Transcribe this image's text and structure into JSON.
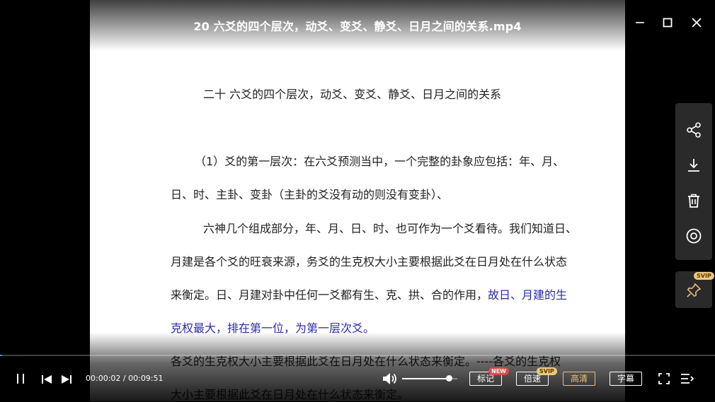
{
  "window": {
    "title": "20   六爻的四个层次，动爻、变爻、静爻、日月之间的关系.mp4"
  },
  "document": {
    "heading": "二十     六爻的四个层次，动爻、变爻、静爻、日月之间的关系",
    "lines": [
      {
        "text": "（1）爻的第一层次：在六爻预测当中，一个完整的卦象应包括：年、月、",
        "indent": true
      },
      {
        "text": "日、时、主卦、变卦（主卦的爻没有动的则没有变卦）、",
        "indent": false
      },
      {
        "text": "六神几个组成部分，年、月、日、时、也可作为一个爻看待。我们知道日、",
        "indent": true
      },
      {
        "text": "月建是各个爻的旺衰来源，务爻的生克权大小主要根据此爻在日月处在什么状态",
        "indent": false
      }
    ],
    "line5_black": "来衡定。日、月建对卦中任何一爻都有生、克、拱、合的作用，",
    "line5_blue": "故日、月建的生",
    "line6_blue": "克权最大，排在第一位，为第一层次爻。",
    "line7": "各爻的生克权大小主要根据此爻在日月处在什么状态来衡定。----各爻的生克权",
    "line8": "大小主要根据此爻在日月处在什么状态来衡定。"
  },
  "side_panel": {
    "icons": [
      "share-icon",
      "download-icon",
      "delete-icon",
      "view-icon"
    ],
    "pin_badge": "SVIP"
  },
  "player": {
    "time_current": "00:00:02",
    "time_separator": " / ",
    "time_total": "00:09:51",
    "progress_fraction": 0.0034,
    "volume_fraction": 0.85,
    "buttons": {
      "mark": "标记",
      "mark_badge": "NEW",
      "speed": "倍速",
      "speed_badge": "SVIP",
      "quality": "高清",
      "subtitle": "字幕"
    },
    "accent_color": "#3a8ef0",
    "gold_color": "#e8c07a"
  }
}
